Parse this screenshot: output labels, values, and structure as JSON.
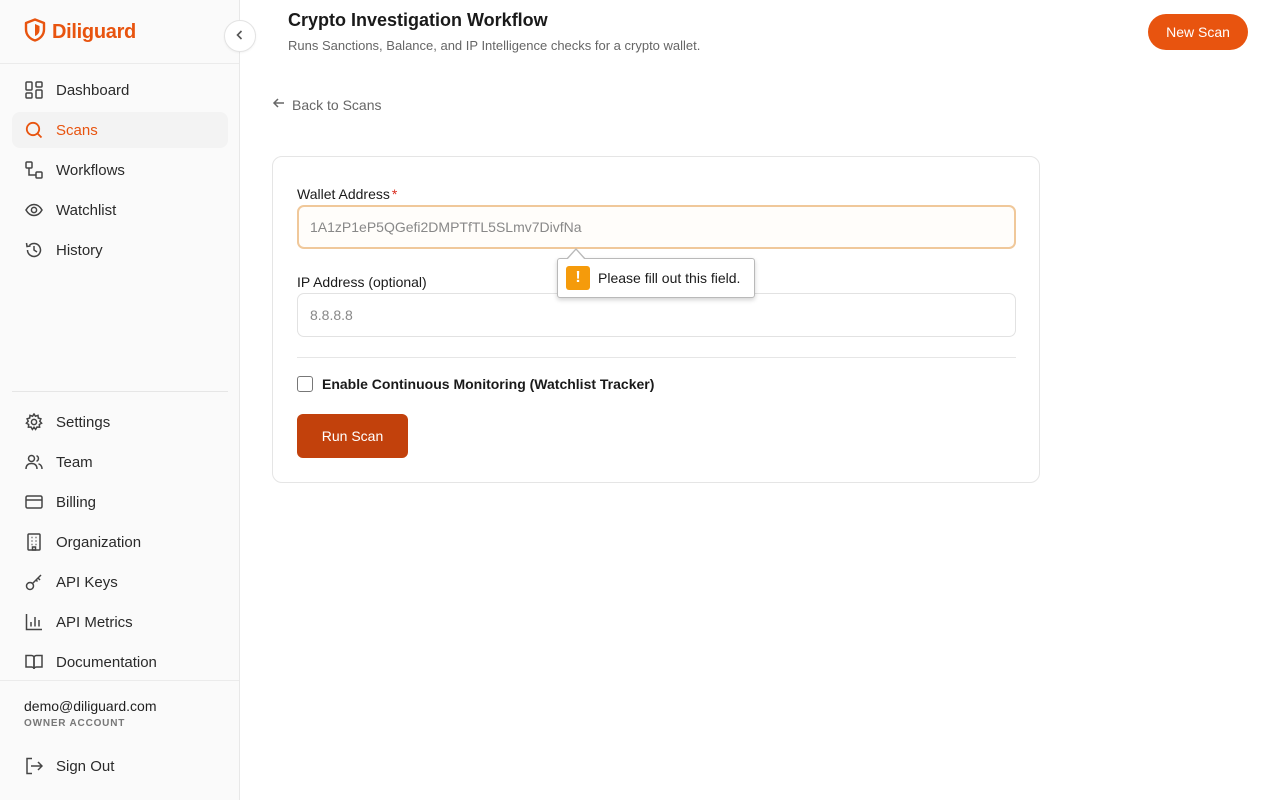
{
  "brand": {
    "name": "Diliguard",
    "accent": "#e8540f"
  },
  "sidebar": {
    "main_items": [
      {
        "label": "Dashboard",
        "icon": "dashboard-icon",
        "active": false
      },
      {
        "label": "Scans",
        "icon": "search-icon",
        "active": true
      },
      {
        "label": "Workflows",
        "icon": "workflow-icon",
        "active": false
      },
      {
        "label": "Watchlist",
        "icon": "eye-icon",
        "active": false
      },
      {
        "label": "History",
        "icon": "history-icon",
        "active": false
      }
    ],
    "secondary_items": [
      {
        "label": "Settings",
        "icon": "gear-icon"
      },
      {
        "label": "Team",
        "icon": "users-icon"
      },
      {
        "label": "Billing",
        "icon": "credit-card-icon"
      },
      {
        "label": "Organization",
        "icon": "building-icon"
      },
      {
        "label": "API Keys",
        "icon": "key-icon"
      },
      {
        "label": "API Metrics",
        "icon": "bar-chart-icon"
      },
      {
        "label": "Documentation",
        "icon": "book-icon"
      }
    ],
    "user": {
      "email": "demo@diliguard.com",
      "role": "OWNER ACCOUNT"
    },
    "sign_out": "Sign Out"
  },
  "header": {
    "title": "Crypto Investigation Workflow",
    "subtitle": "Runs Sanctions, Balance, and IP Intelligence checks for a crypto wallet.",
    "new_scan": "New Scan"
  },
  "back_link": "Back to Scans",
  "form": {
    "wallet_label": "Wallet Address",
    "wallet_required": "*",
    "wallet_placeholder": "1A1zP1eP5QGefi2DMPTfTL5SLmv7DivfNa",
    "ip_label": "IP Address (optional)",
    "ip_placeholder": "8.8.8.8",
    "monitoring_label": "Enable Continuous Monitoring (Watchlist Tracker)",
    "monitoring_checked": false,
    "submit": "Run Scan"
  },
  "validation": {
    "message": "Please fill out this field.",
    "icon": "warning-icon"
  }
}
